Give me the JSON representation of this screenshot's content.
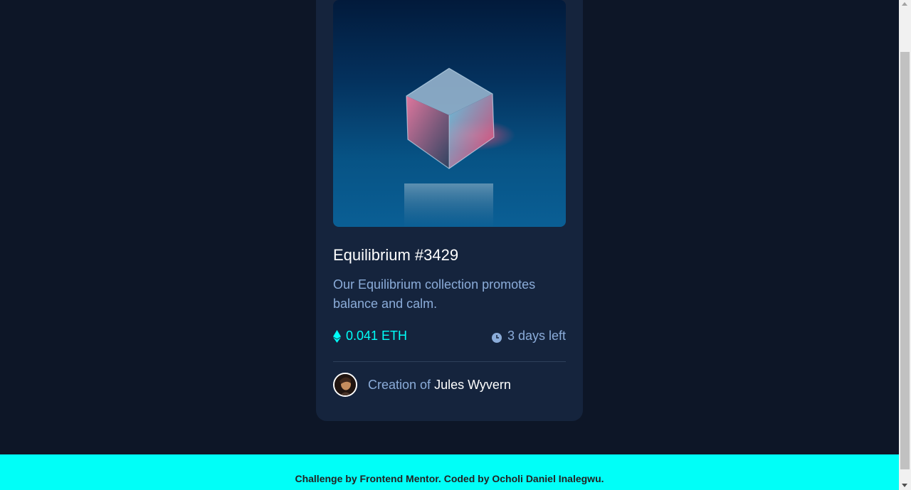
{
  "card": {
    "title": "Equilibrium #3429",
    "description": "Our Equilibrium collection promotes balance and calm.",
    "price": "0.041 ETH",
    "time_left": "3 days left",
    "creator_prefix": "Creation of",
    "creator_name": "Jules Wyvern",
    "image_icon": "cube-image",
    "price_icon": "ethereum-icon",
    "time_icon": "clock-icon"
  },
  "footer": {
    "text": "Challenge by Frontend Mentor. Coded by Ocholi Daniel Inalegwu."
  },
  "colors": {
    "background": "#0d1627",
    "card": "#15243d",
    "accent": "#00fff8",
    "soft_blue": "#8bacd9",
    "white": "#ffffff"
  }
}
